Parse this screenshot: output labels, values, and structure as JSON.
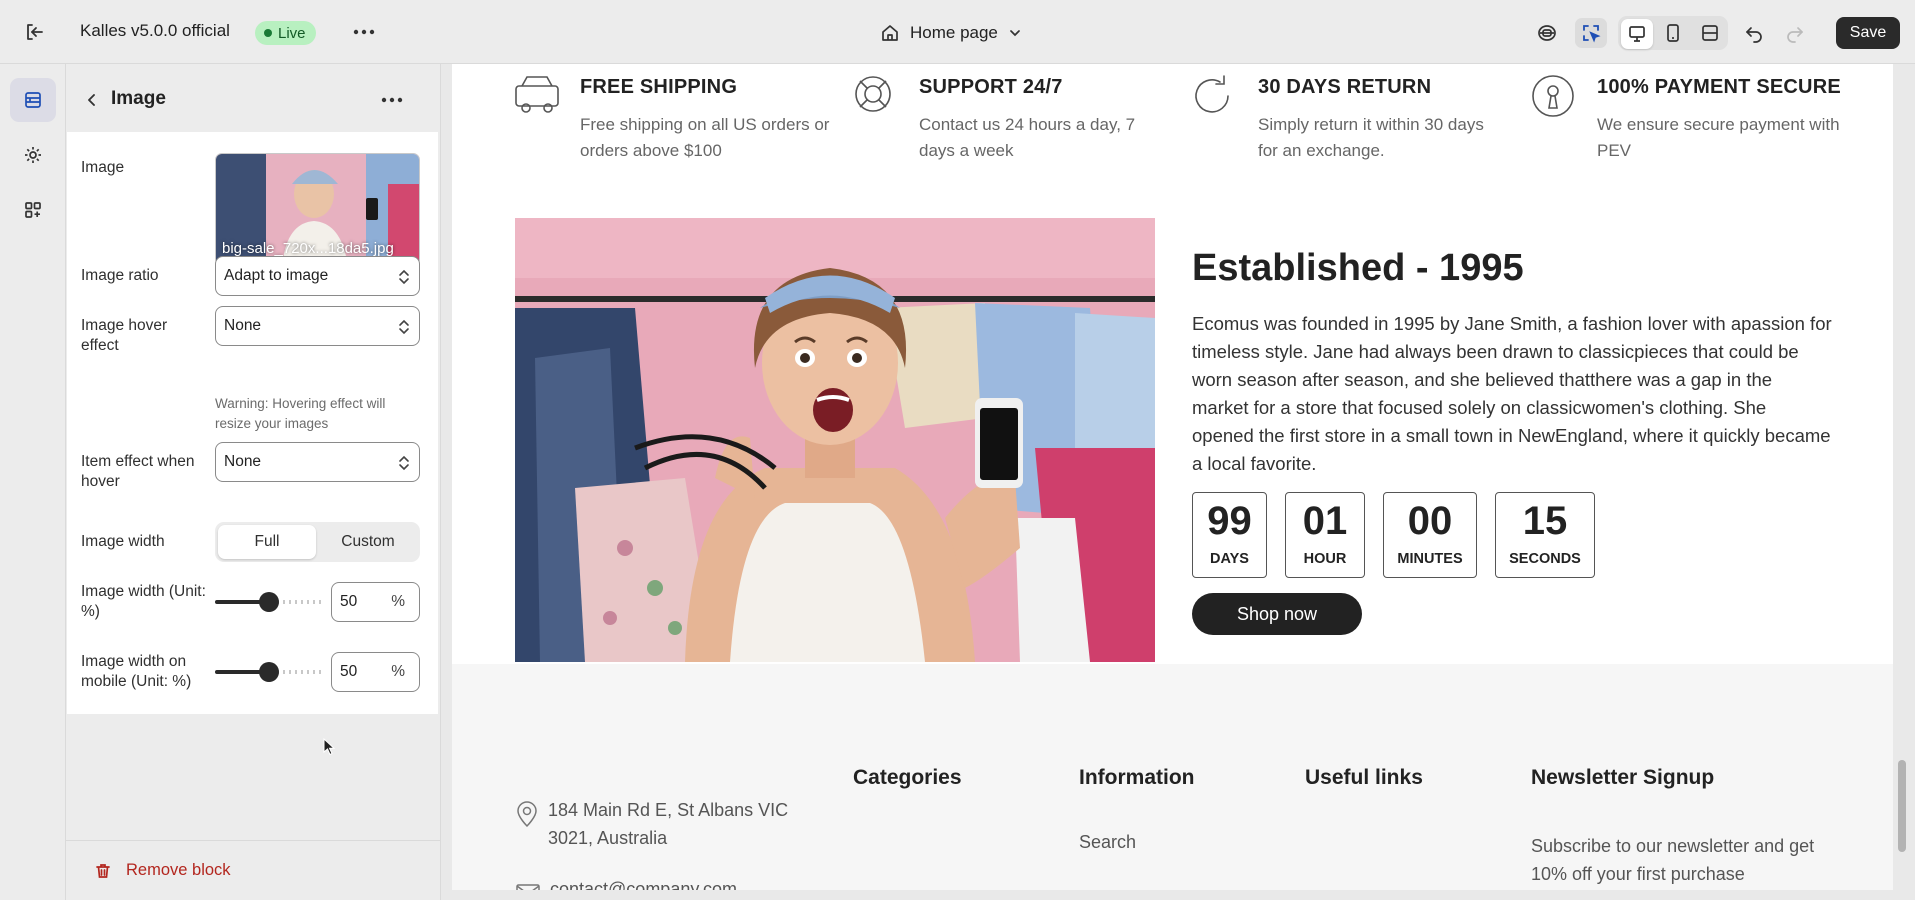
{
  "topbar": {
    "store_name": "Kalles v5.0.0 official",
    "status_badge": "Live",
    "page_selector": "Home page",
    "save_label": "Save"
  },
  "panel": {
    "title": "Image",
    "image_label": "Image",
    "image_filename": "big-sale_720x...18da5.jpg",
    "ratio_label": "Image ratio",
    "ratio_value": "Adapt to image",
    "hover_label": "Image hover effect",
    "hover_value": "None",
    "hover_warning": "Warning: Hovering effect will resize your images",
    "item_effect_label": "Item effect when hover",
    "item_effect_value": "None",
    "width_label": "Image width",
    "width_options": [
      "Full",
      "Custom"
    ],
    "width_selected": "Full",
    "width_pct_label": "Image width (Unit: %)",
    "width_pct_value": "50",
    "width_pct_unit": "%",
    "width_mobile_label": "Image width on mobile (Unit: %)",
    "width_mobile_value": "50",
    "width_mobile_unit": "%",
    "remove_label": "Remove block"
  },
  "preview": {
    "features": [
      {
        "icon": "truck-icon",
        "title": "FREE SHIPPING",
        "desc": "Free shipping on all US orders or orders above $100"
      },
      {
        "icon": "lifebuoy-icon",
        "title": "SUPPORT 24/7",
        "desc": "Contact us 24 hours a day, 7 days a week"
      },
      {
        "icon": "refresh-icon",
        "title": "30 DAYS RETURN",
        "desc": "Simply return it within 30 days for an exchange."
      },
      {
        "icon": "secure-payment-icon",
        "title": "100% PAYMENT SECURE",
        "desc": "We ensure secure payment with PEV"
      }
    ],
    "about_title": "Established - 1995",
    "about_text": "Ecomus was founded in 1995 by Jane Smith, a fashion lover with apassion for timeless style. Jane had always been drawn to classicpieces that could be worn season after season, and she believed thatthere was a gap in the market for a store that focused solely on classicwomen's clothing. She opened the first store in a small town in NewEngland, where it quickly became a local favorite.",
    "countdown": [
      {
        "value": "99",
        "label": "DAYS"
      },
      {
        "value": "01",
        "label": "HOUR"
      },
      {
        "value": "00",
        "label": "MINUTES"
      },
      {
        "value": "15",
        "label": "SECONDS"
      }
    ],
    "shop_button": "Shop now",
    "footer": {
      "address": "184 Main Rd E, St Albans VIC 3021, Australia",
      "email": "contact@company.com",
      "columns": [
        "Categories",
        "Information",
        "Useful links",
        "Newsletter Signup"
      ],
      "info_link": "Search",
      "newsletter_text": "Subscribe to our newsletter and get 10% off your first purchase"
    }
  },
  "colors": {
    "accent": "#1f4fb5",
    "live_badge": "#b8f0c0",
    "danger": "#b3261e",
    "dark_button": "#2a2a2a"
  }
}
